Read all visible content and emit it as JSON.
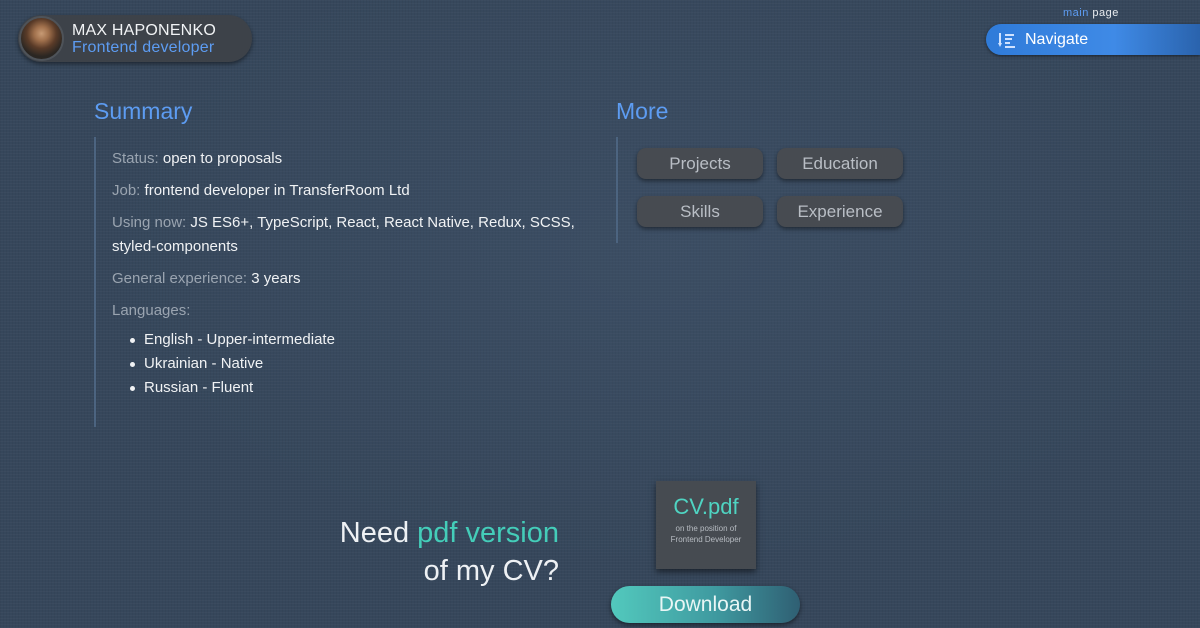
{
  "profile": {
    "name": "MAX HAPONENKO",
    "role": "Frontend developer"
  },
  "top_nav": {
    "main_page_accent": "main",
    "main_page_rest": "page",
    "navigate_label": "Navigate",
    "navigate_icon": "sort-descending-icon"
  },
  "summary": {
    "heading": "Summary",
    "status_label": "Status:",
    "status_value": "open to proposals",
    "job_label": "Job:",
    "job_value": "frontend developer in TransferRoom Ltd",
    "using_label": "Using now:",
    "using_value": "JS ES6+, TypeScript, React, React Native, Redux, SCSS, styled-components",
    "experience_label": "General experience:",
    "experience_value": "3 years",
    "languages_label": "Languages:",
    "languages": [
      "English - Upper-intermediate",
      "Ukrainian - Native",
      "Russian - Fluent"
    ]
  },
  "more": {
    "heading": "More",
    "buttons": [
      "Projects",
      "Education",
      "Skills",
      "Experience"
    ]
  },
  "pdf": {
    "need": "Need",
    "accent": "pdf version",
    "rest": "of my CV?",
    "card_title": "CV.pdf",
    "card_sub": "on the position of Frontend Developer",
    "download_label": "Download"
  },
  "colors": {
    "background": "#36475b",
    "accent_blue": "#5d9cf2",
    "accent_teal": "#44cdb9",
    "button_bg": "#474b51"
  }
}
